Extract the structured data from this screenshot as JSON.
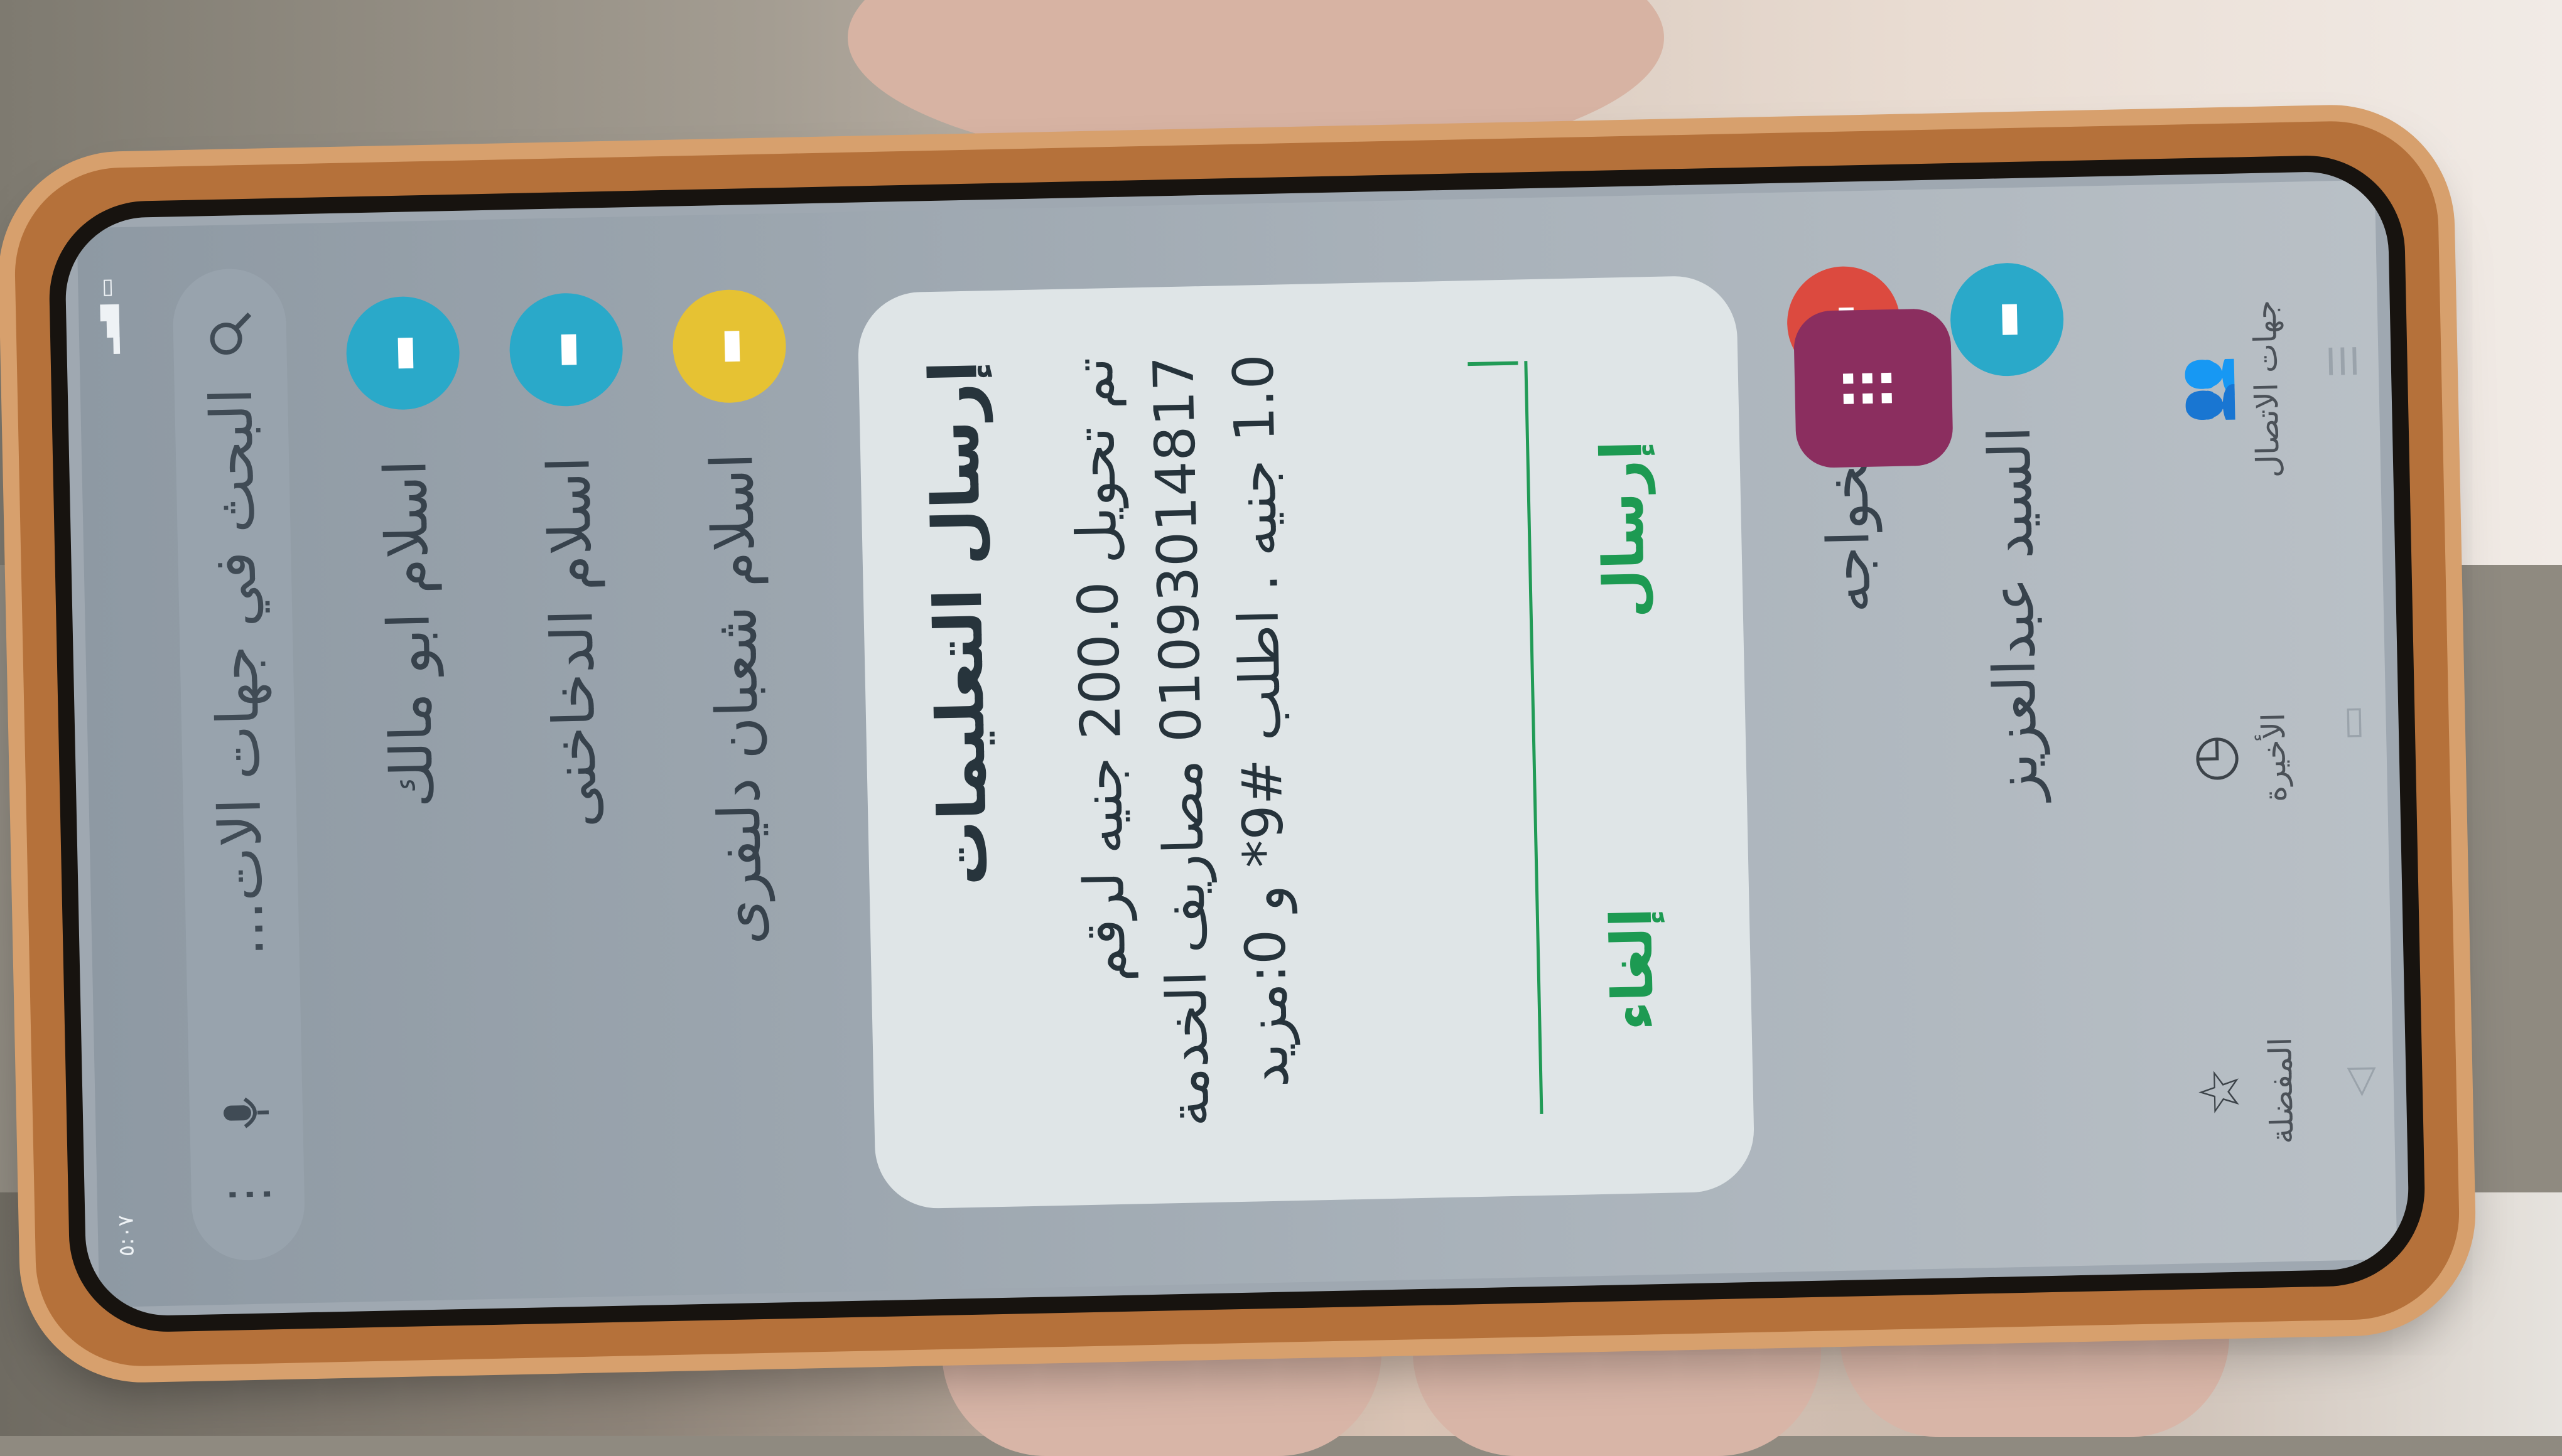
{
  "status_bar": {
    "time": "٥:٠٧"
  },
  "search": {
    "placeholder": "البحث في جهات الات...",
    "search_icon": "search-icon",
    "mic_icon": "mic-icon",
    "more_icon": "more-vertical-icon"
  },
  "contacts": [
    {
      "name": "اسلام ابو مالك",
      "avatar_color": "#2aa9c9"
    },
    {
      "name": "اسلام الدخاخنى",
      "avatar_color": "#2aa9c9"
    },
    {
      "name": "اسلام شعبان دليفرى",
      "avatar_color": "#e6c233"
    }
  ],
  "dialog": {
    "title": "إرسال التعليمات",
    "message": "تم تحويل 200.0 جنيه لرقم 01093014817 مصاريف الخدمة 1.0 جنيه . اطلب #9* و 0:مزيد",
    "send_label": "إرسال",
    "cancel_label": "إلغاء"
  },
  "favorites": [
    {
      "name": "الخواجه",
      "avatar_color": "#dc4a3f"
    },
    {
      "name": "السيد عبدالعزيز",
      "avatar_color": "#2aa9c9"
    }
  ],
  "fab": {
    "icon": "dialpad-icon",
    "color": "#8b2e5f"
  },
  "tabs": [
    {
      "label": "جهات الاتصال",
      "icon": "contacts-icon"
    },
    {
      "label": "الأخيرة",
      "icon": "clock-icon"
    },
    {
      "label": "المفضلة",
      "icon": "star-icon"
    }
  ],
  "nav": {
    "back_icon": "back-icon",
    "home_icon": "home-icon",
    "recents_icon": "recents-icon"
  }
}
